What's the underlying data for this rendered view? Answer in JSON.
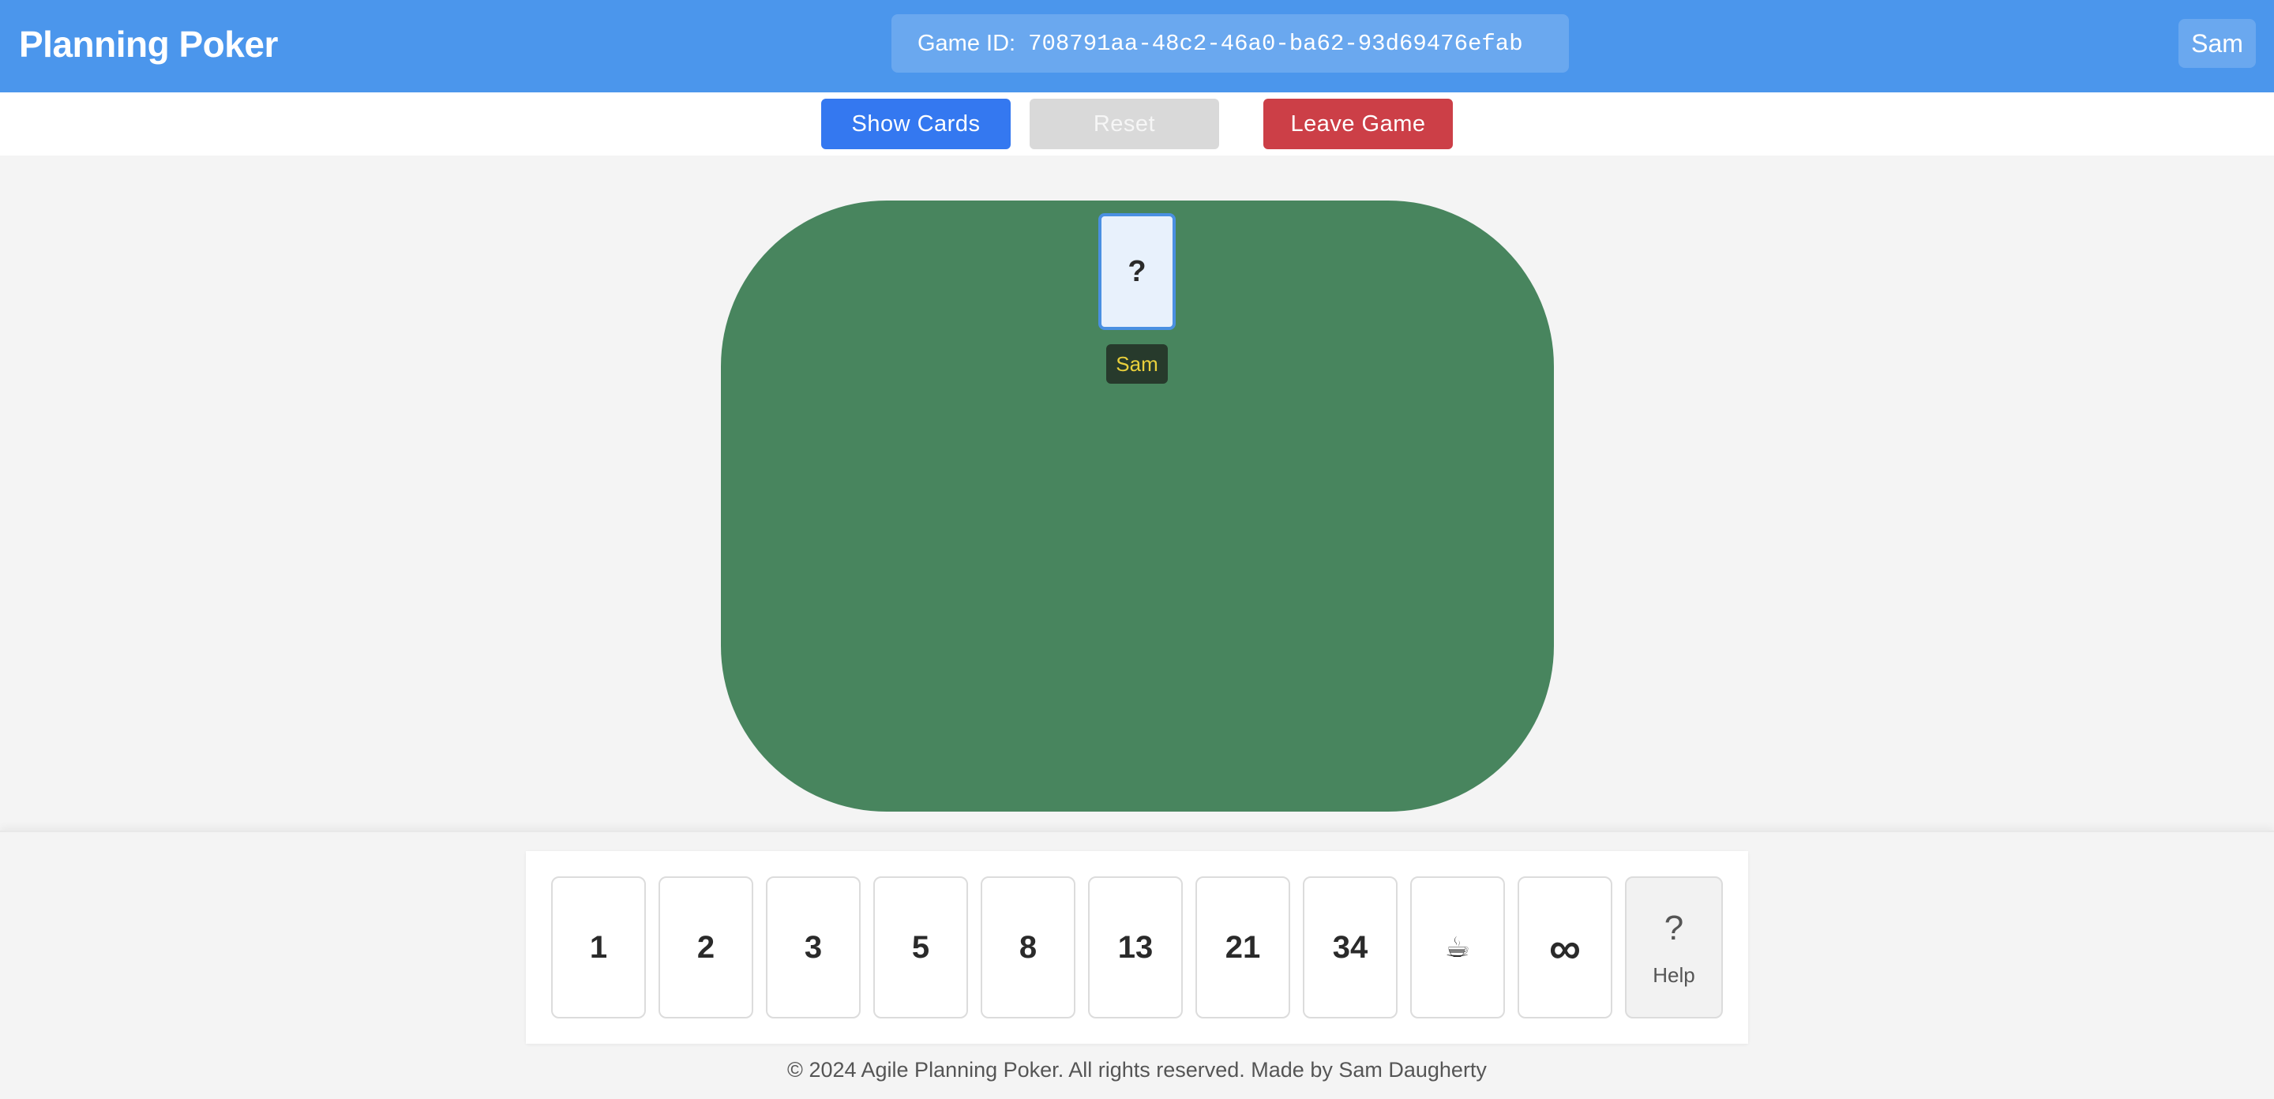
{
  "header": {
    "title": "Planning Poker",
    "game_id_label": "Game ID:",
    "game_id_value": "708791aa-48c2-46a0-ba62-93d69476efab",
    "user": "Sam"
  },
  "toolbar": {
    "show_cards": "Show Cards",
    "reset": "Reset",
    "leave_game": "Leave Game"
  },
  "table": {
    "players": [
      {
        "name": "Sam",
        "card": "?"
      }
    ]
  },
  "deck": {
    "cards": [
      "1",
      "2",
      "3",
      "5",
      "8",
      "13",
      "21",
      "34",
      "☕",
      "∞"
    ],
    "help_icon": "?",
    "help_label": "Help"
  },
  "footer": {
    "text": "© 2024 Agile Planning Poker. All rights reserved. Made by Sam Daugherty"
  },
  "colors": {
    "header": "#4b96ec",
    "table": "#48855e",
    "show_button": "#3478f0",
    "leave_button": "#cc3f47",
    "player_name_text": "#e8cf3c"
  }
}
